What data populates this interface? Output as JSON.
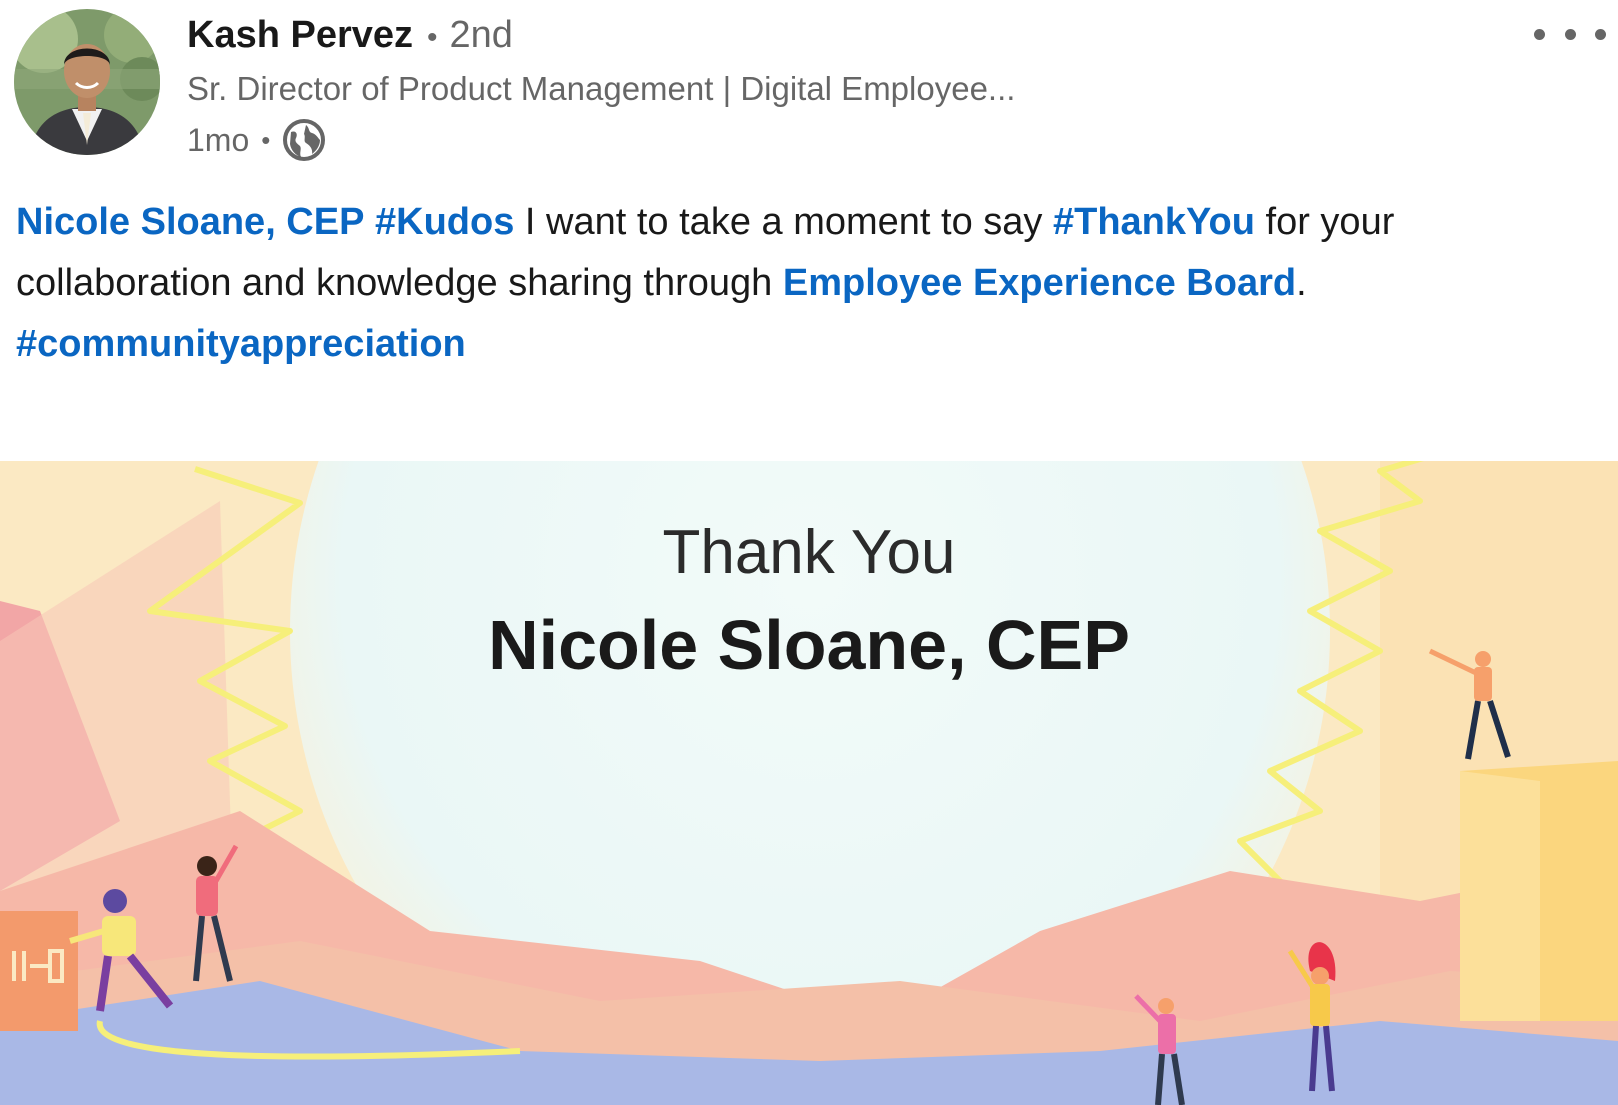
{
  "post": {
    "actor": {
      "name": "Kash Pervez",
      "degree": "2nd",
      "headline": "Sr. Director of Product Management | Digital Employee...",
      "time": "1mo",
      "separator": "•",
      "visibility_icon": "globe-icon",
      "avatar_icon": "avatar"
    },
    "more_actions_icon": "ellipsis-icon",
    "commentary": {
      "mention": "Nicole Sloane, CEP",
      "hashtag_kudos": "#Kudos",
      "text_1": " I want to take a moment to say ",
      "hashtag_thankyou": "#ThankYou",
      "text_2": " for your collaboration and knowledge sharing through ",
      "page_mention": "Employee Experience Board",
      "text_3": ".",
      "hashtag_community": "#communityappreciation"
    },
    "image": {
      "line_1": "Thank You",
      "line_2": "Nicole Sloane, CEP"
    }
  },
  "colors": {
    "link": "#0a66c2",
    "text_primary": "rgba(0,0,0,0.9)",
    "text_secondary": "rgba(0,0,0,0.6)"
  }
}
